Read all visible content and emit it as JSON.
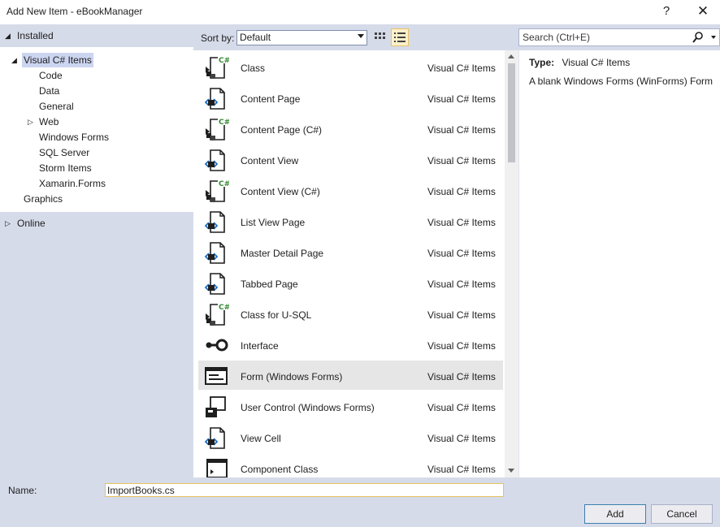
{
  "window": {
    "title": "Add New Item - eBookManager",
    "help": "?",
    "close": "✕"
  },
  "tree": {
    "installed": "Installed",
    "visual_cs": "Visual C# Items",
    "children": [
      "Code",
      "Data",
      "General",
      "Web",
      "Windows Forms",
      "SQL Server",
      "Storm Items",
      "Xamarin.Forms"
    ],
    "graphics": "Graphics",
    "online": "Online"
  },
  "toolbar": {
    "sort_label": "Sort by:",
    "sort_value": "Default",
    "search_placeholder": "Search (Ctrl+E)"
  },
  "items": [
    {
      "name": "Class",
      "category": "Visual C# Items",
      "icon": "csharp-file-icon"
    },
    {
      "name": "Content Page",
      "category": "Visual C# Items",
      "icon": "xaml-page-icon"
    },
    {
      "name": "Content Page (C#)",
      "category": "Visual C# Items",
      "icon": "csharp-file-icon"
    },
    {
      "name": "Content View",
      "category": "Visual C# Items",
      "icon": "xaml-page-icon"
    },
    {
      "name": "Content View (C#)",
      "category": "Visual C# Items",
      "icon": "csharp-file-icon"
    },
    {
      "name": "List View Page",
      "category": "Visual C# Items",
      "icon": "xaml-page-icon"
    },
    {
      "name": "Master Detail Page",
      "category": "Visual C# Items",
      "icon": "xaml-page-icon"
    },
    {
      "name": "Tabbed Page",
      "category": "Visual C# Items",
      "icon": "xaml-page-icon"
    },
    {
      "name": "Class for U-SQL",
      "category": "Visual C# Items",
      "icon": "csharp-file-icon"
    },
    {
      "name": "Interface",
      "category": "Visual C# Items",
      "icon": "interface-icon"
    },
    {
      "name": "Form (Windows Forms)",
      "category": "Visual C# Items",
      "icon": "windows-form-icon"
    },
    {
      "name": "User Control (Windows Forms)",
      "category": "Visual C# Items",
      "icon": "user-control-icon"
    },
    {
      "name": "View Cell",
      "category": "Visual C# Items",
      "icon": "xaml-page-icon"
    },
    {
      "name": "Component Class",
      "category": "Visual C# Items",
      "icon": "component-icon"
    }
  ],
  "selected_index": 10,
  "details": {
    "type_label": "Type:",
    "type_value": "Visual C# Items",
    "description": "A blank Windows Forms (WinForms) Form"
  },
  "name_field": {
    "label": "Name:",
    "value": "ImportBooks.cs"
  },
  "buttons": {
    "add": "Add",
    "cancel": "Cancel"
  },
  "colors": {
    "panel": "#d6dbe9",
    "selection": "#ccd5f0",
    "accent_csharp": "#388a34",
    "accent_blue": "#1e6fc7"
  }
}
